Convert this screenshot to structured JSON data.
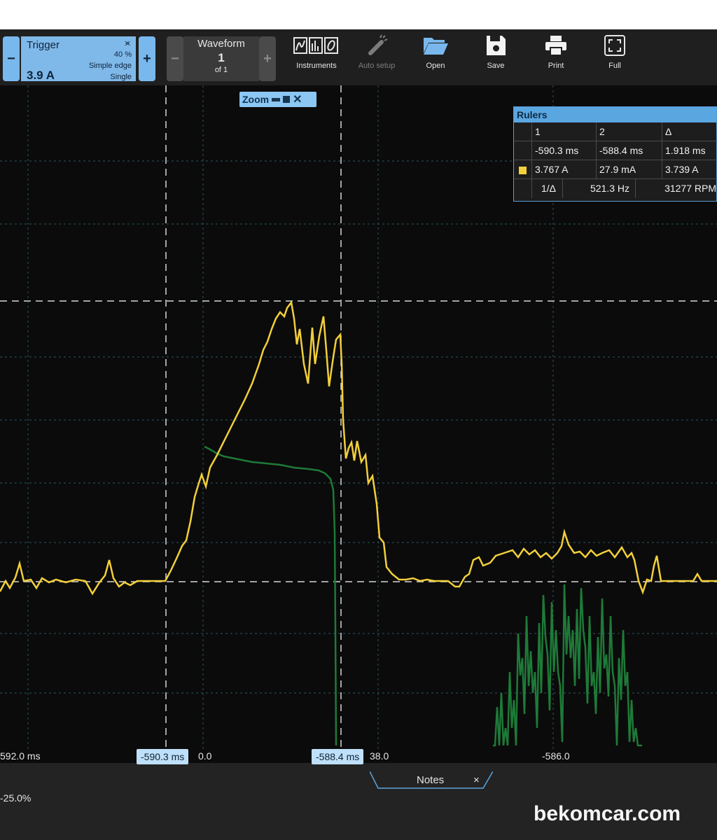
{
  "trigger": {
    "title": "Trigger",
    "value": "3.9 A",
    "edge_symbol": "⪤",
    "percent": "40 %",
    "mode": "Simple edge",
    "run": "Single",
    "minus": "−",
    "plus": "+"
  },
  "waveform": {
    "title": "Waveform",
    "index": "1",
    "of": "of 1",
    "minus": "−",
    "plus": "+"
  },
  "toolbar": {
    "instruments": "Instruments",
    "auto_setup": "Auto setup",
    "open": "Open",
    "save": "Save",
    "print": "Print",
    "full": "Full"
  },
  "zoom": {
    "label": "Zoom"
  },
  "rulers": {
    "title": "Rulers",
    "headers": [
      "1",
      "2",
      "Δ"
    ],
    "time_row": [
      "-590.3 ms",
      "-588.4 ms",
      "1.918 ms"
    ],
    "value_row": [
      "3.767 A",
      "27.9 mA",
      "3.739 A"
    ],
    "freq_label": "1/Δ",
    "freq": "521.3 Hz",
    "rpm": "31277 RPM"
  },
  "axis": {
    "x_ticks": [
      "592.0 ms",
      "0.0",
      "38.0",
      "-586.0"
    ]
  },
  "cursor_tags": [
    "-590.3 ms",
    "-588.4 ms"
  ],
  "notes": {
    "label": "Notes",
    "close": "×"
  },
  "status": {
    "offset": "-25.0%"
  },
  "watermark": "bekomcar.com",
  "colors": {
    "yellow_trace": "#f2cf3a",
    "green_trace": "#1e7a38",
    "accent": "#7fb9ea"
  }
}
